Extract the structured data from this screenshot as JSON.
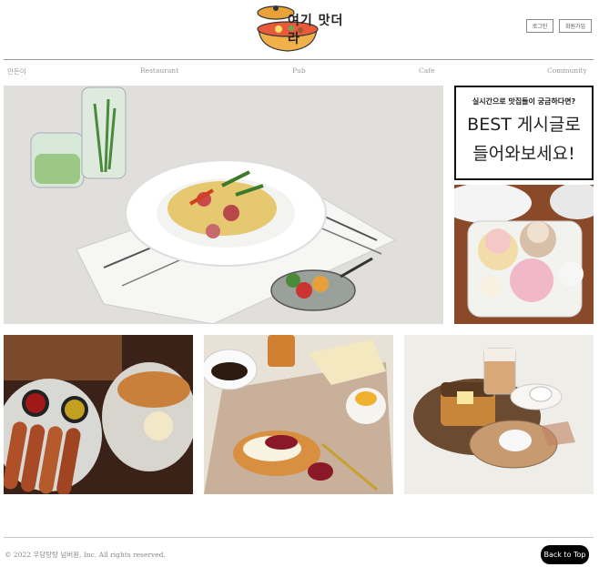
{
  "header": {
    "logo_text": "여기 맛더라",
    "login_label": "로그인",
    "signup_label": "회원가입"
  },
  "nav": {
    "items": [
      "만든이",
      "Restaurant",
      "Pub",
      "Cafe",
      "Community"
    ]
  },
  "promo": {
    "question": "실시간으로 맛집들이 궁금하다면?",
    "headline_line1": "BEST 게시글로",
    "headline_line2": "들어와보세요!"
  },
  "photos": {
    "main": "pasta-dish",
    "side": "cupcakes",
    "row": [
      "sausage-board",
      "breakfast-spread",
      "toast-and-coffee"
    ]
  },
  "footer": {
    "copyright": "© 2022 우당탕탕 넘버원, Inc. All rights reserved.",
    "back_to_top": "Back to Top"
  }
}
